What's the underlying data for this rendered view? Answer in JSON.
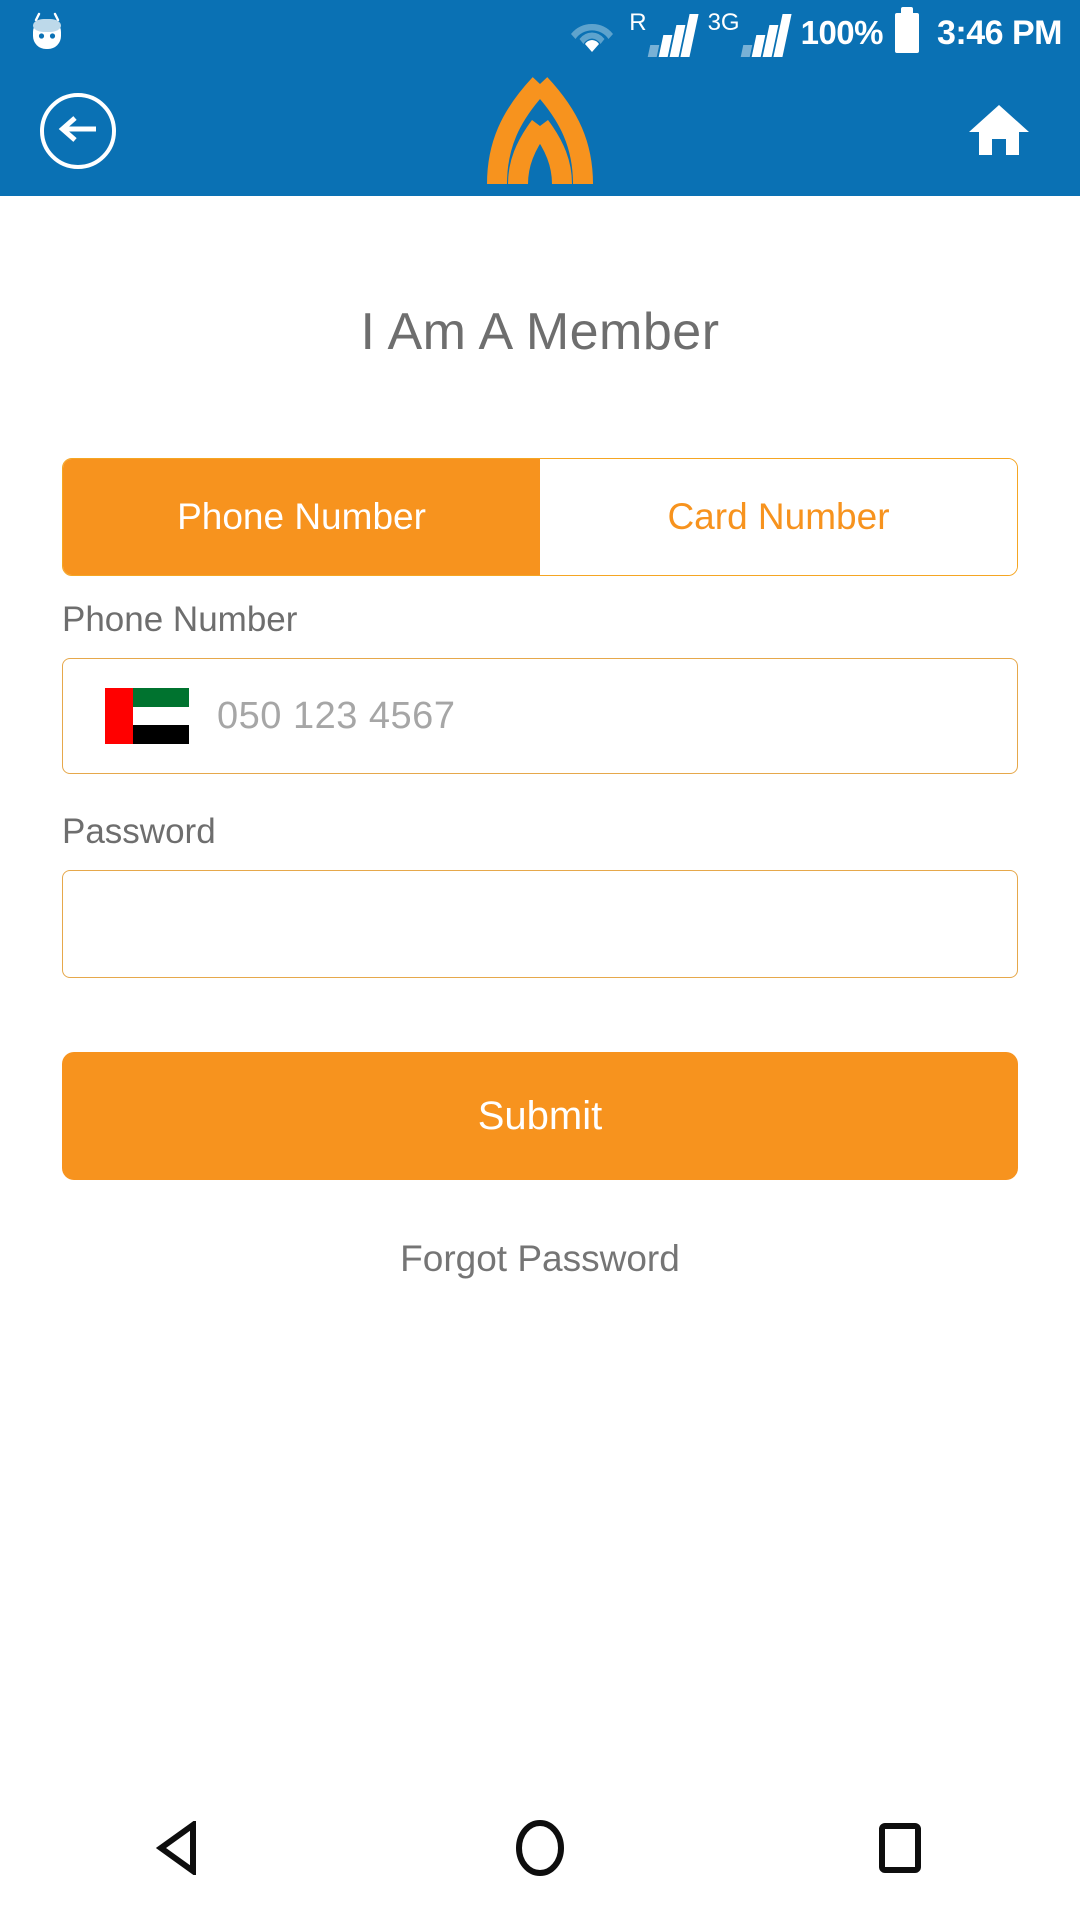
{
  "status_bar": {
    "notification_icon": "cyanogenmod-robot-icon",
    "wifi_icon": "wifi-icon",
    "sim1": {
      "label": "R",
      "icon": "signal-bars-icon"
    },
    "sim2": {
      "label": "3G",
      "icon": "signal-bars-icon"
    },
    "battery_percent": "100%",
    "battery_icon": "battery-full-icon",
    "time": "3:46 PM",
    "background_color": "#0a71b4"
  },
  "app_header": {
    "back_icon": "back-arrow-circle-icon",
    "logo_icon": "app-logo-icon",
    "home_icon": "home-icon",
    "background_color": "#0a71b4",
    "logo_color": "#f7931e"
  },
  "main": {
    "page_title": "I Am A Member",
    "tabs": [
      {
        "label": "Phone Number",
        "active": true
      },
      {
        "label": "Card Number",
        "active": false
      }
    ],
    "phone_field": {
      "label": "Phone Number",
      "flag_icon": "uae-flag-icon",
      "placeholder": "050 123 4567",
      "value": ""
    },
    "password_field": {
      "label": "Password",
      "placeholder": "",
      "value": ""
    },
    "submit_label": "Submit",
    "forgot_password_label": "Forgot Password",
    "accent_color": "#f7931e",
    "border_color": "#e6a84b",
    "text_color": "#6e6e6e"
  },
  "nav_bar": {
    "back_icon": "nav-back-triangle-icon",
    "home_icon": "nav-home-circle-icon",
    "recents_icon": "nav-recents-square-icon"
  }
}
